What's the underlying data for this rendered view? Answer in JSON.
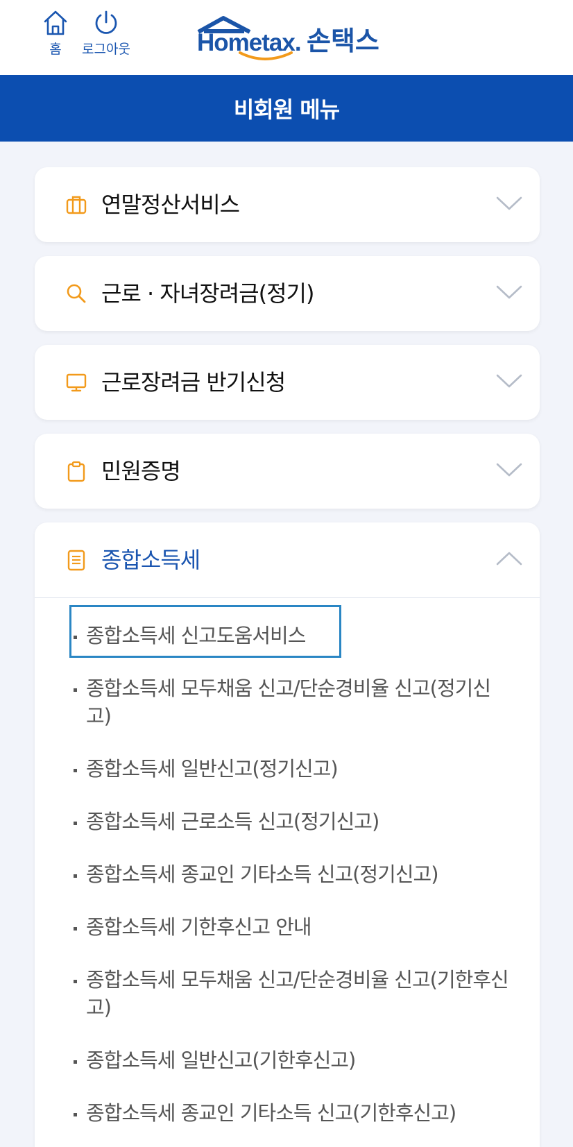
{
  "topbar": {
    "home_label": "홈",
    "logout_label": "로그아웃",
    "logo_hometax": "Hometax.",
    "logo_sontax": "손택스"
  },
  "title": "비회원 메뉴",
  "colors": {
    "brand_blue": "#0c4eb0",
    "accent_orange": "#f29a1b",
    "background": "#f2f4fa"
  },
  "menu": [
    {
      "label": "연말정산서비스",
      "icon": "briefcase-icon",
      "expanded": false
    },
    {
      "label": "근로 · 자녀장려금(정기)",
      "icon": "search-icon",
      "expanded": false
    },
    {
      "label": "근로장려금 반기신청",
      "icon": "monitor-icon",
      "expanded": false
    },
    {
      "label": "민원증명",
      "icon": "clipboard-icon",
      "expanded": false
    },
    {
      "label": "종합소득세",
      "icon": "document-icon",
      "expanded": true,
      "items": [
        "종합소득세 신고도움서비스",
        "종합소득세 모두채움 신고/단순경비율 신고(정기신고)",
        "종합소득세 일반신고(정기신고)",
        "종합소득세 근로소득 신고(정기신고)",
        "종합소득세 종교인 기타소득 신고(정기신고)",
        "종합소득세 기한후신고 안내",
        "종합소득세 모두채움 신고/단순경비율 신고(기한후신고)",
        "종합소득세 일반신고(기한후신고)",
        "종합소득세 종교인 기타소득 신고(기한후신고)"
      ]
    }
  ]
}
